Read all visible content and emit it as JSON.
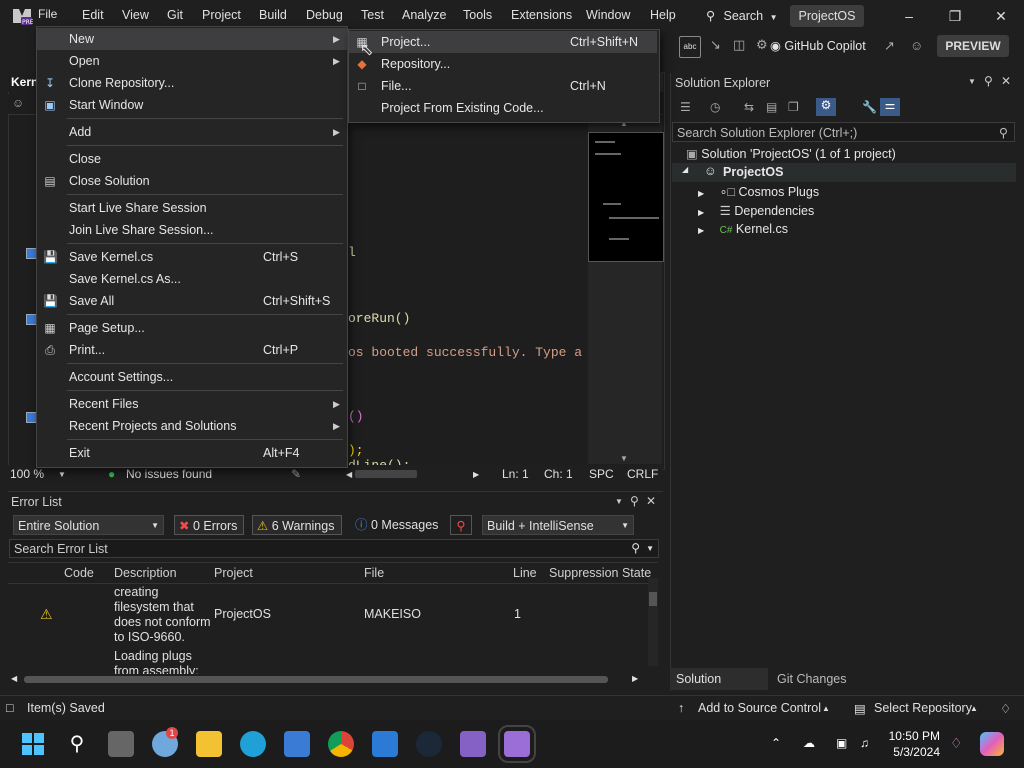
{
  "menubar": {
    "items": [
      "File",
      "Edit",
      "View",
      "Git",
      "Project",
      "Build",
      "Debug",
      "Test",
      "Analyze",
      "Tools",
      "Extensions",
      "Window",
      "Help"
    ],
    "search_label": "Search",
    "project_name": "ProjectOS"
  },
  "toolbar": {
    "copilot_label": "GitHub Copilot",
    "preview_label": "PREVIEW"
  },
  "editor": {
    "tab_label": "Kern",
    "code_fragments": [
      "l",
      "oreRun()",
      "os booted successfully. Type a l",
      "()",
      ");",
      "dLine();"
    ],
    "status": {
      "zoom": "100 %",
      "issues": "No issues found",
      "line": "Ln: 1",
      "col": "Ch: 1",
      "spc": "SPC",
      "eol": "CRLF"
    }
  },
  "file_menu": {
    "items": [
      {
        "label": "New",
        "shortcut": "",
        "submenu": true
      },
      {
        "label": "Open",
        "shortcut": "",
        "submenu": true
      },
      {
        "label": "Clone Repository...",
        "shortcut": ""
      },
      {
        "label": "Start Window",
        "shortcut": ""
      },
      {
        "label": "Add",
        "shortcut": "",
        "submenu": true
      },
      {
        "label": "Close",
        "shortcut": ""
      },
      {
        "label": "Close Solution",
        "shortcut": ""
      },
      {
        "label": "Start Live Share Session",
        "shortcut": ""
      },
      {
        "label": "Join Live Share Session...",
        "shortcut": ""
      },
      {
        "label": "Save Kernel.cs",
        "shortcut": "Ctrl+S"
      },
      {
        "label": "Save Kernel.cs As...",
        "shortcut": ""
      },
      {
        "label": "Save All",
        "shortcut": "Ctrl+Shift+S"
      },
      {
        "label": "Page Setup...",
        "shortcut": ""
      },
      {
        "label": "Print...",
        "shortcut": "Ctrl+P"
      },
      {
        "label": "Account Settings...",
        "shortcut": ""
      },
      {
        "label": "Recent Files",
        "shortcut": "",
        "submenu": true
      },
      {
        "label": "Recent Projects and Solutions",
        "shortcut": "",
        "submenu": true
      },
      {
        "label": "Exit",
        "shortcut": "Alt+F4"
      }
    ]
  },
  "new_submenu": {
    "items": [
      {
        "label": "Project...",
        "shortcut": "Ctrl+Shift+N"
      },
      {
        "label": "Repository...",
        "shortcut": ""
      },
      {
        "label": "File...",
        "shortcut": "Ctrl+N"
      },
      {
        "label": "Project From Existing Code...",
        "shortcut": ""
      }
    ]
  },
  "solution_explorer": {
    "title": "Solution Explorer",
    "search_placeholder": "Search Solution Explorer (Ctrl+;)",
    "solution": "Solution 'ProjectOS' (1 of 1 project)",
    "project": "ProjectOS",
    "children": [
      "Cosmos Plugs",
      "Dependencies",
      "Kernel.cs"
    ],
    "tabs": [
      "Solution Explorer",
      "Git Changes"
    ]
  },
  "error_list": {
    "title": "Error List",
    "scope": "Entire Solution",
    "errors": "0 Errors",
    "warnings": "6 Warnings",
    "messages": "0 Messages",
    "build_filter": "Build + IntelliSense",
    "search_placeholder": "Search Error List",
    "columns": [
      "Code",
      "Description",
      "Project",
      "File",
      "Line",
      "Suppression State"
    ],
    "rows": [
      {
        "description": "creating filesystem that does not conform to ISO-9660.",
        "project": "ProjectOS",
        "file": "MAKEISO",
        "line": "1"
      },
      {
        "description": "Loading plugs from assembly:",
        "project": "",
        "file": "",
        "line": ""
      }
    ]
  },
  "statusbar": {
    "left": "Item(s) Saved",
    "source_control": "Add to Source Control",
    "repo": "Select Repository"
  },
  "taskbar": {
    "time": "10:50 PM",
    "date": "5/3/2024",
    "notification_badge": "1"
  }
}
